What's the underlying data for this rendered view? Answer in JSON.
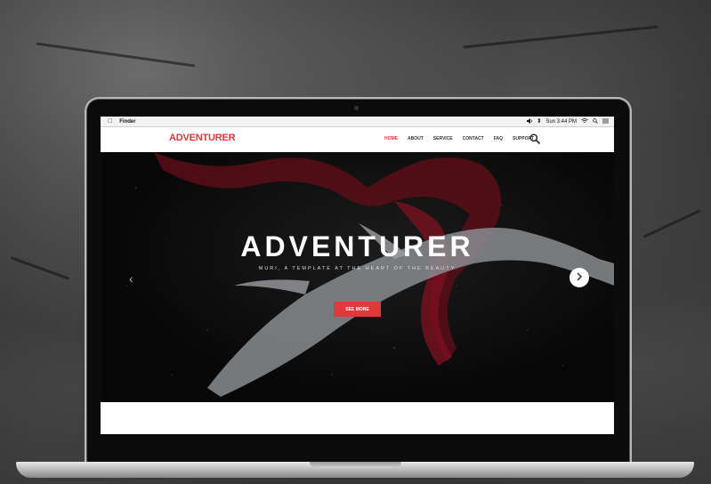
{
  "menubar": {
    "app_name": "Finder",
    "clock": "Sun 3:44 PM"
  },
  "site": {
    "logo": "ADVENTURER",
    "nav": [
      {
        "label": "HOME",
        "active": true
      },
      {
        "label": "ABOUT",
        "active": false
      },
      {
        "label": "SERVICE",
        "active": false
      },
      {
        "label": "CONTACT",
        "active": false
      },
      {
        "label": "FAQ",
        "active": false
      },
      {
        "label": "SUPPORT",
        "active": false
      }
    ]
  },
  "hero": {
    "title": "ADVENTURER",
    "subtitle": "MURI, A TEMPLATE AT THE HEART OF THE BEAUTY",
    "cta_label": "SEE MORE"
  },
  "colors": {
    "accent": "#e0393b",
    "hero_bg": "#0a0a0a"
  },
  "icons": [
    "apple-icon",
    "volume-icon",
    "bluetooth-icon",
    "wifi-icon",
    "search-icon",
    "list-icon",
    "chevron-left-icon",
    "chevron-right-icon"
  ]
}
